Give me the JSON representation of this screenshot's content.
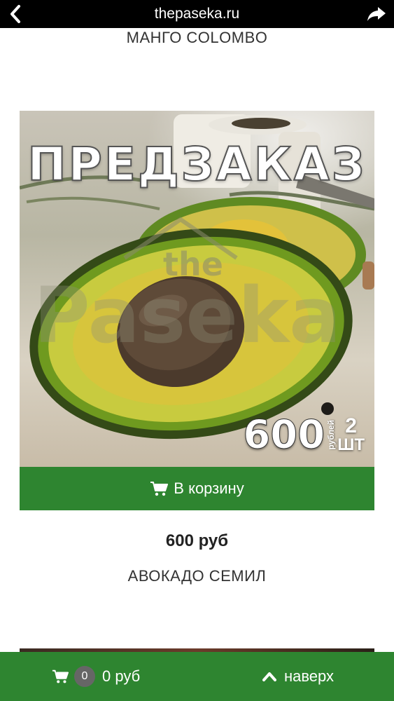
{
  "browser": {
    "url": "thepaseka.ru",
    "icons": {
      "back": "chevron-left-icon",
      "share": "share-arrow-icon"
    }
  },
  "products": {
    "top_title": "МАНГО COLOMBO",
    "avocado": {
      "image_overlay_text": "ПРЕДЗАКАЗ",
      "watermark": "the Paseka",
      "badge": {
        "price": "600",
        "unit": "рублей",
        "qty": "2",
        "qty_unit": "ШТ"
      },
      "cart_button_label": "В корзину",
      "price": "600 руб",
      "name": "АВОКАДО СЕМИЛ"
    }
  },
  "bottom_bar": {
    "cart_count": "0",
    "cart_total": "0 руб",
    "to_top_label": "наверх"
  },
  "colors": {
    "accent_green": "#2e8530",
    "topbar": "#000000",
    "badge_gray": "#666666"
  }
}
